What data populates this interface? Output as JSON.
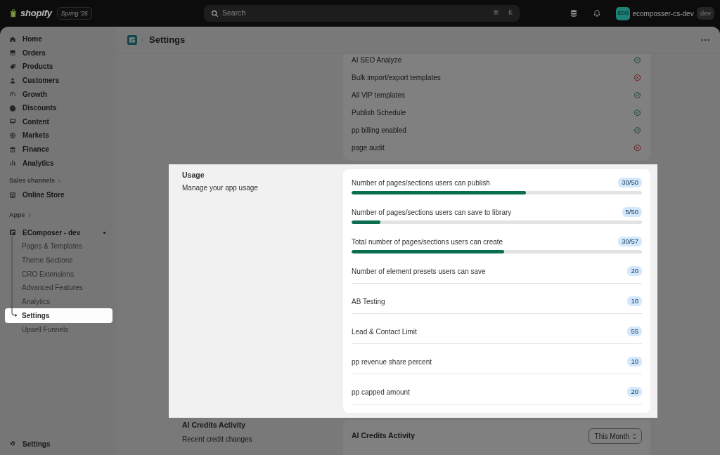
{
  "spotlight_tour": {
    "active": true
  },
  "top_bar": {
    "logo_text": "shopify",
    "edition": "Spring '26",
    "search": {
      "placeholder": "Search"
    },
    "shortcut_keys": [
      "⌘",
      "K"
    ],
    "store": {
      "avatar_text": "ECO",
      "name": "ecomposser-cs-dev",
      "badge": "dev"
    }
  },
  "sidebar": {
    "items": [
      {
        "label": "Home"
      },
      {
        "label": "Orders"
      },
      {
        "label": "Products"
      },
      {
        "label": "Customers"
      },
      {
        "label": "Growth"
      },
      {
        "label": "Discounts"
      },
      {
        "label": "Content"
      },
      {
        "label": "Markets"
      },
      {
        "label": "Finance"
      },
      {
        "label": "Analytics"
      }
    ],
    "groups": [
      {
        "heading": "Sales channels",
        "items": [
          {
            "label": "Online Store"
          }
        ]
      },
      {
        "heading": "Apps",
        "items": [
          {
            "label": "EComposer - dev",
            "children": [
              {
                "label": "Pages & Templates",
                "selected": false
              },
              {
                "label": "Theme Sections",
                "selected": false
              },
              {
                "label": "CRO Extensions",
                "selected": false
              },
              {
                "label": "Advanced Features",
                "selected": false
              },
              {
                "label": "Analytics",
                "selected": false
              },
              {
                "label": "Settings",
                "selected": true
              },
              {
                "label": "Upsell Funnels",
                "selected": false
              }
            ]
          }
        ]
      }
    ],
    "footer_item": {
      "label": "Settings"
    }
  },
  "page": {
    "title": "Settings",
    "sections": [
      {
        "kind": "features",
        "highlighted": false,
        "features": [
          {
            "label": "AI SEO Analyze",
            "enabled": true
          },
          {
            "label": "Bulk import/export templates",
            "enabled": false
          },
          {
            "label": "All VIP templates",
            "enabled": true
          },
          {
            "label": "Publish Schedule",
            "enabled": true
          },
          {
            "label": "pp billing enabled",
            "enabled": true
          },
          {
            "label": "page audit",
            "enabled": false
          }
        ]
      },
      {
        "kind": "usage",
        "highlighted": true,
        "title": "Usage",
        "description": "Manage your app usage",
        "limits": [
          {
            "kind": "progress",
            "label": "Number of pages/sections users can publish",
            "value": "30/50",
            "level": 0.6
          },
          {
            "kind": "progress",
            "label": "Number of pages/sections users can save to library",
            "value": "5/50",
            "level": 0.1
          },
          {
            "kind": "progress",
            "label": "Total number of pages/sections users can create",
            "value": "30/57",
            "level": 0.526
          },
          {
            "kind": "count",
            "label": "Number of element presets users can save",
            "value": "20"
          },
          {
            "kind": "count",
            "label": "AB Testing",
            "value": "10"
          },
          {
            "kind": "count",
            "label": "Lead & Contact Limit",
            "value": "55"
          },
          {
            "kind": "count",
            "label": "pp revenue share percent",
            "value": "10"
          },
          {
            "kind": "count",
            "label": "pp capped amount",
            "value": "20"
          }
        ]
      },
      {
        "kind": "activity",
        "highlighted": false,
        "title": "AI Credits Activity",
        "description": "Recent credit changes",
        "card_title": "AI Credits Activity",
        "period": "This Month"
      }
    ]
  }
}
